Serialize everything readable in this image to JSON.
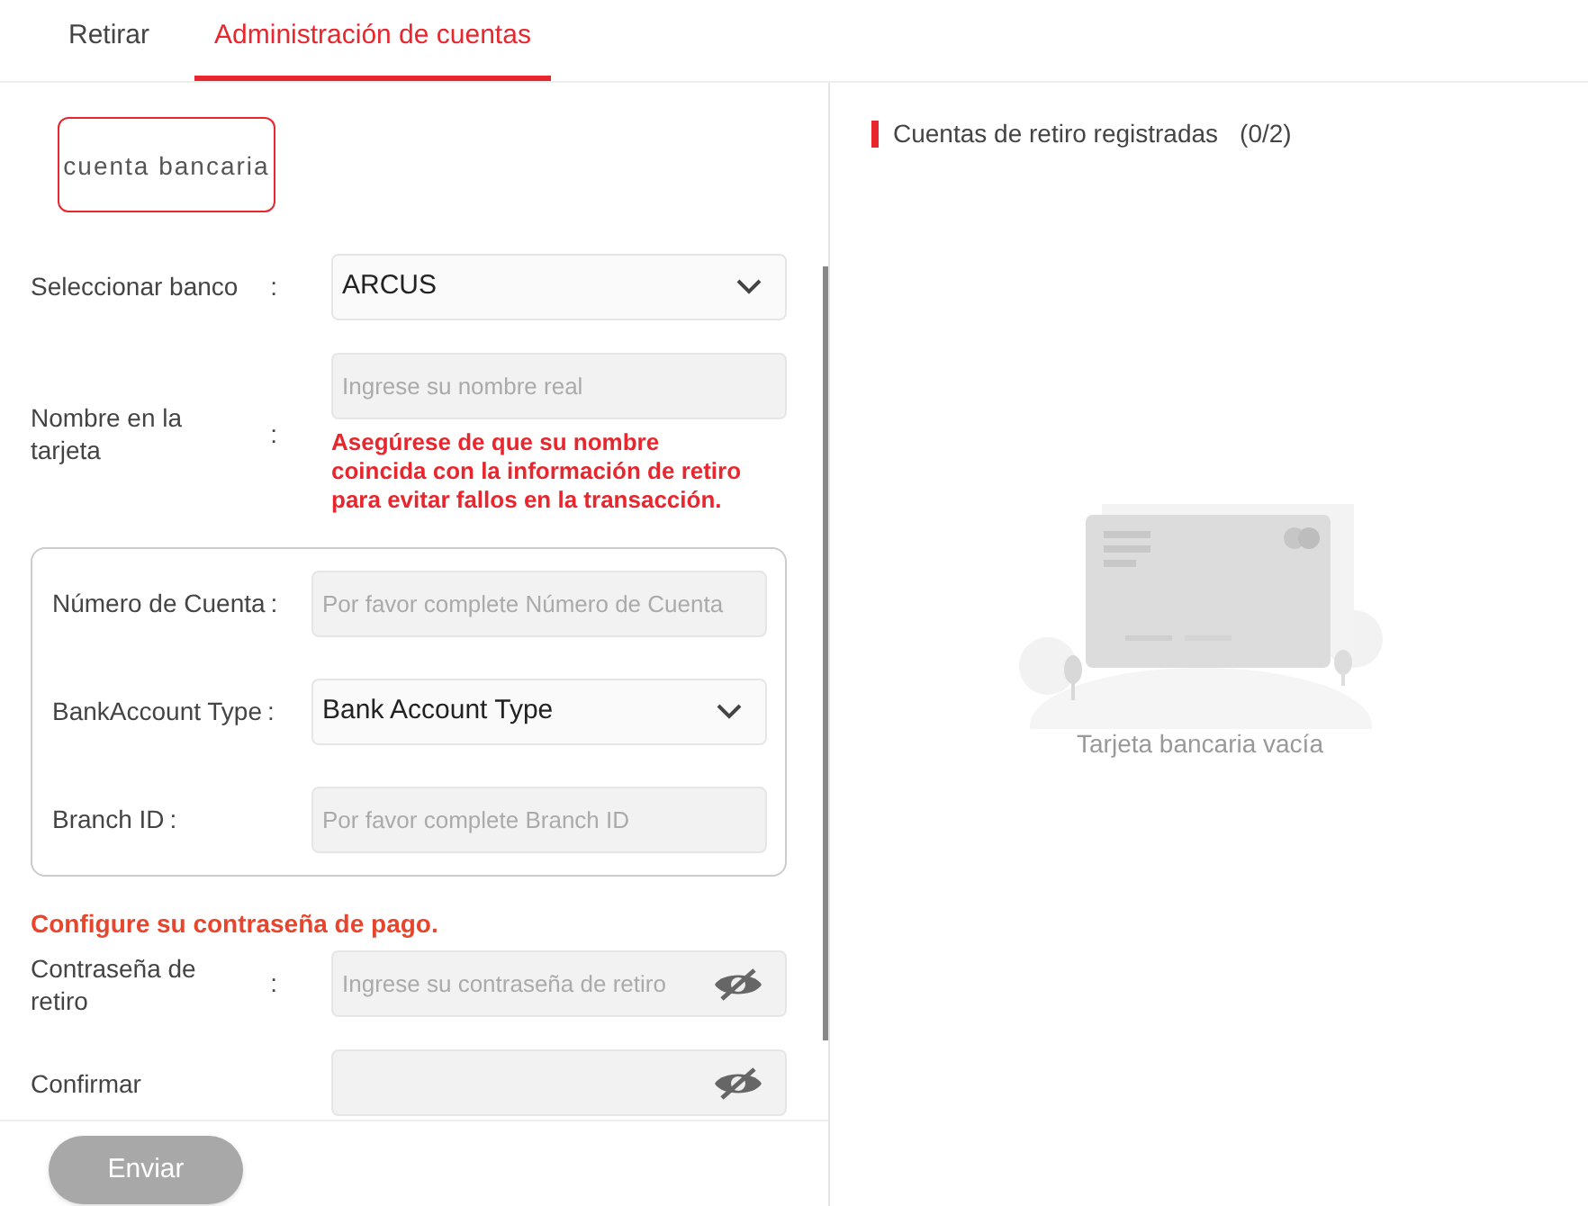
{
  "tabs": [
    {
      "label": "Retirar",
      "selected": false
    },
    {
      "label": "Administración de cuentas",
      "selected": true
    }
  ],
  "account_types": [
    {
      "label": "cuenta bancaria",
      "selected": true
    }
  ],
  "fields": [
    {
      "kind": "select",
      "label": "Seleccionar banco",
      "colon": ":",
      "value": "ARCUS"
    },
    {
      "kind": "input",
      "label": "Nombre en la tarjeta",
      "colon": ":",
      "placeholder": "Ingrese su nombre real",
      "note": "Asegúrese de que su nombre coincida con la información de retiro para evitar fallos en la transacción."
    }
  ],
  "bank_details": [
    {
      "kind": "input",
      "label": "Número de Cuenta",
      "colon": ":",
      "placeholder": "Por favor complete Número de Cuenta"
    },
    {
      "kind": "select",
      "label": "BankAccount Type",
      "colon": ":",
      "value": "Bank Account Type"
    },
    {
      "kind": "input",
      "label": "Branch ID",
      "colon": ":",
      "placeholder": "Por favor complete Branch ID"
    }
  ],
  "password_heading": "Configure su contraseña de pago.",
  "password_fields": [
    {
      "kind": "password",
      "label": "Contraseña de retiro",
      "colon": ":",
      "placeholder": "Ingrese su contraseña de retiro"
    },
    {
      "kind": "password",
      "label": "Confirmar"
    }
  ],
  "submit": {
    "label": "Enviar",
    "disabled": true
  },
  "accounts_panel": {
    "title": "Cuentas de retiro registradas",
    "count": "(0/2)",
    "empty_text": "Tarjeta bancaria vacía"
  }
}
